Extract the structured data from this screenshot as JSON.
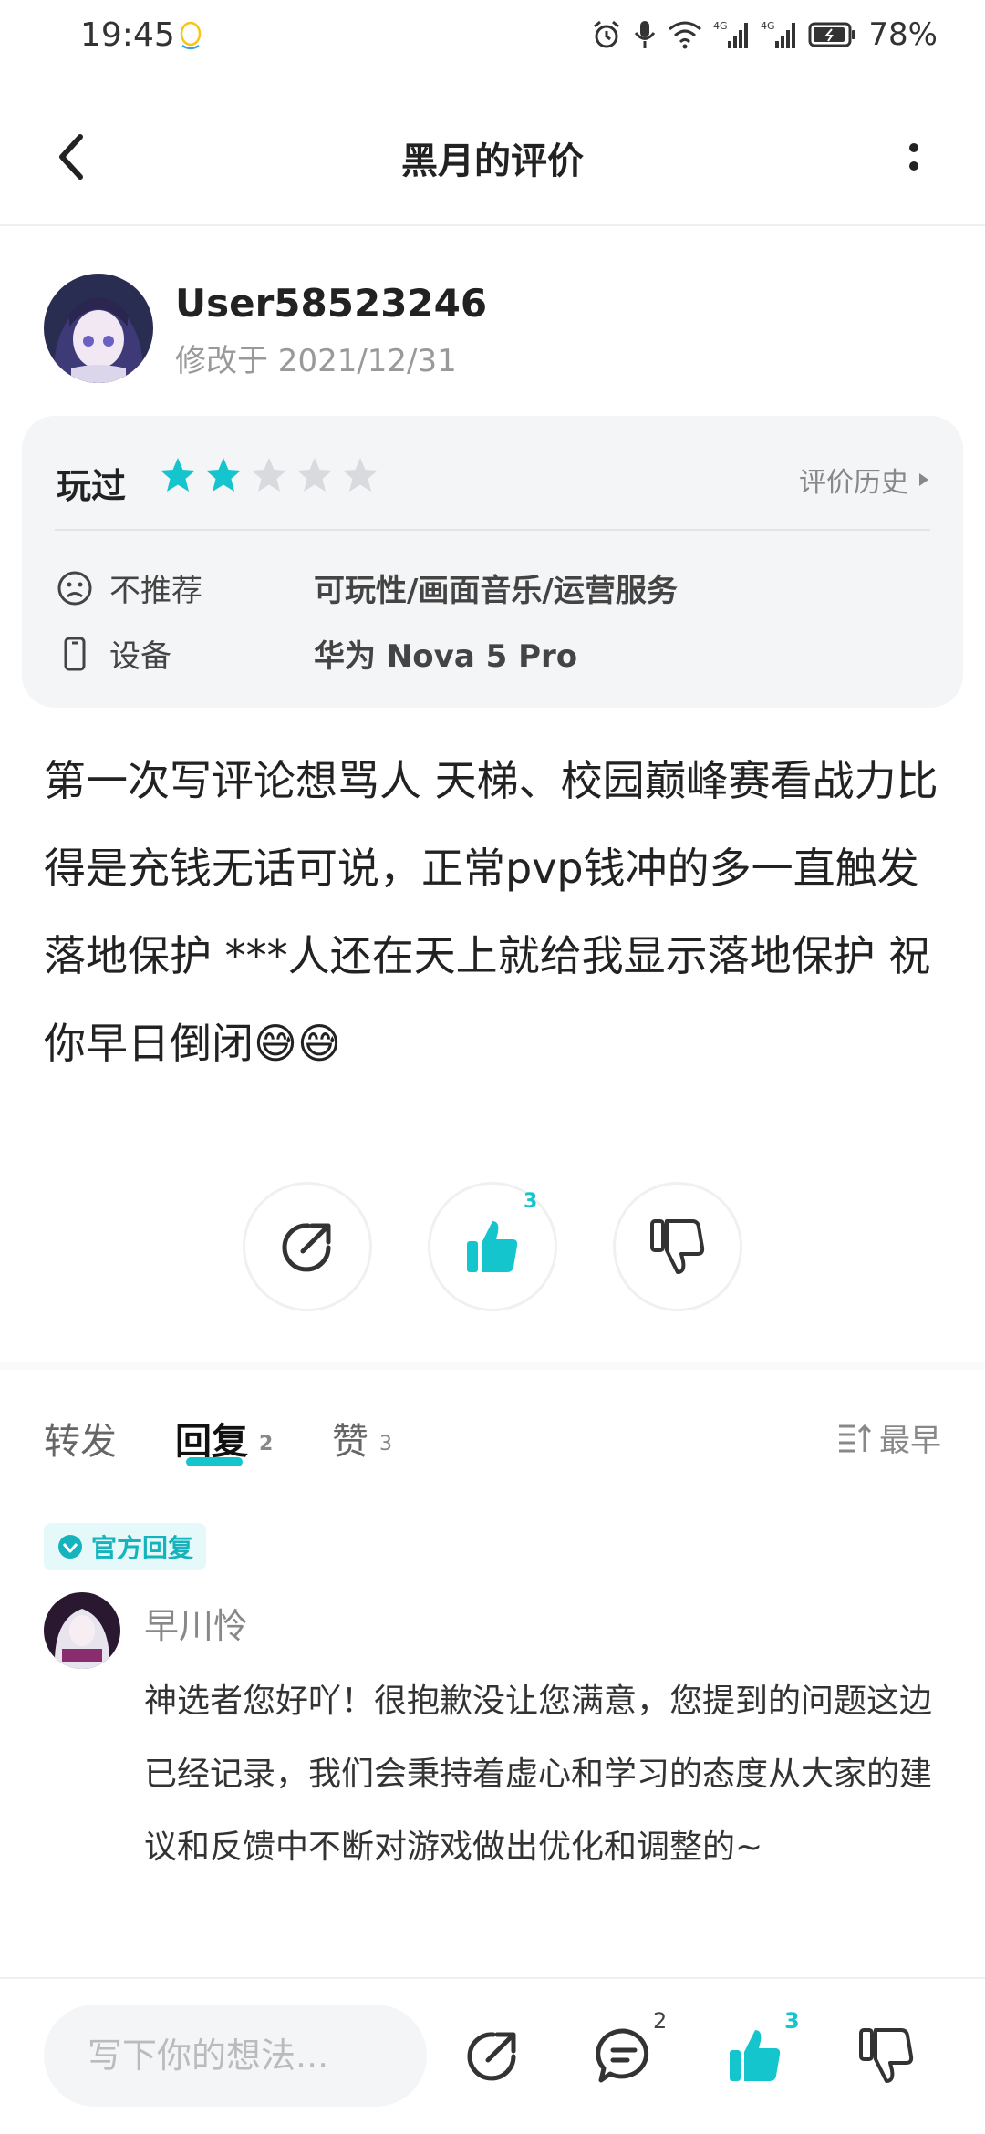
{
  "status_bar": {
    "time": "19:45",
    "battery": "78%",
    "network_1": "4G",
    "network_2": "4G"
  },
  "header": {
    "title": "黑月的评价"
  },
  "user": {
    "name": "User58523246",
    "modified": "修改于 2021/12/31"
  },
  "rating_card": {
    "played_label": "玩过",
    "rating": 2,
    "max_rating": 5,
    "history_label": "评价历史",
    "recommend_label": "不推荐",
    "recommend_value": "可玩性/画面音乐/运营服务",
    "device_label": "设备",
    "device_value": "华为 Nova 5 Pro"
  },
  "review": {
    "text": "第一次写评论想骂人 天梯、校园巅峰赛看战力比得是充钱无话可说，正常pvp钱冲的多一直触发落地保护 ***人还在天上就给我显示落地保护 祝你早日倒闭😅😅"
  },
  "actions": {
    "like_count": "3"
  },
  "tabs": [
    {
      "label": "转发",
      "count": ""
    },
    {
      "label": "回复",
      "count": "2"
    },
    {
      "label": "赞",
      "count": "3"
    }
  ],
  "sort_label": "最早",
  "official_reply": {
    "badge": "官方回复",
    "name": "早川怜",
    "text": "神选者您好吖！很抱歉没让您满意，您提到的问题这边已经记录，我们会秉持着虚心和学习的态度从大家的建议和反馈中不断对游戏做出优化和调整的~"
  },
  "bottom_bar": {
    "input_placeholder": "写下你的想法...",
    "comment_count": "2",
    "like_count": "3"
  },
  "colors": {
    "accent": "#15c5ce",
    "star_off": "#d8dadd"
  }
}
